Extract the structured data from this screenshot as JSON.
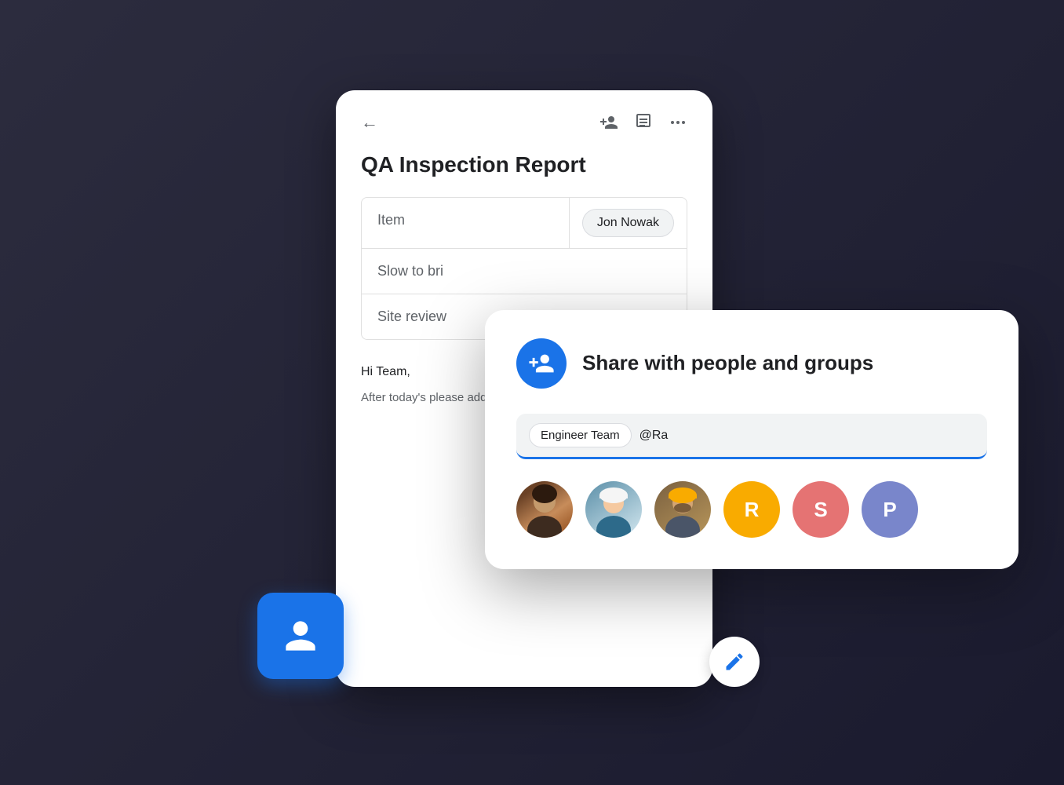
{
  "doc": {
    "title": "QA Inspection Report",
    "header_icons": {
      "back": "←",
      "add_person": "person-add-icon",
      "notes": "notes-icon",
      "more": "more-icon"
    },
    "table": {
      "rows": [
        {
          "left": "Item",
          "right": "Jon Nowak",
          "has_badge": true
        },
        {
          "left": "Slow to bri",
          "right": "",
          "has_badge": false
        },
        {
          "left": "Site review",
          "right": "",
          "has_badge": false
        }
      ]
    },
    "body": {
      "greeting": "Hi Team,",
      "text": "After today's please add y working doc before next week."
    }
  },
  "share_dialog": {
    "title": "Share with people and groups",
    "chip_label": "Engineer Team",
    "input_value": "@Ra",
    "input_placeholder": "@Ra",
    "avatars": [
      {
        "type": "photo",
        "label": "person-1",
        "color": "#8b6c5c"
      },
      {
        "type": "photo",
        "label": "person-2",
        "color": "#7aa3b8"
      },
      {
        "type": "photo",
        "label": "person-3",
        "color": "#9b8060"
      },
      {
        "type": "letter",
        "label": "R",
        "color": "#f9ab00"
      },
      {
        "type": "letter",
        "label": "S",
        "color": "#e57373"
      },
      {
        "type": "letter",
        "label": "P",
        "color": "#7986cb"
      }
    ]
  },
  "blue_folder": {
    "label": "folder-icon"
  },
  "edit_fab": {
    "label": "edit-button"
  }
}
